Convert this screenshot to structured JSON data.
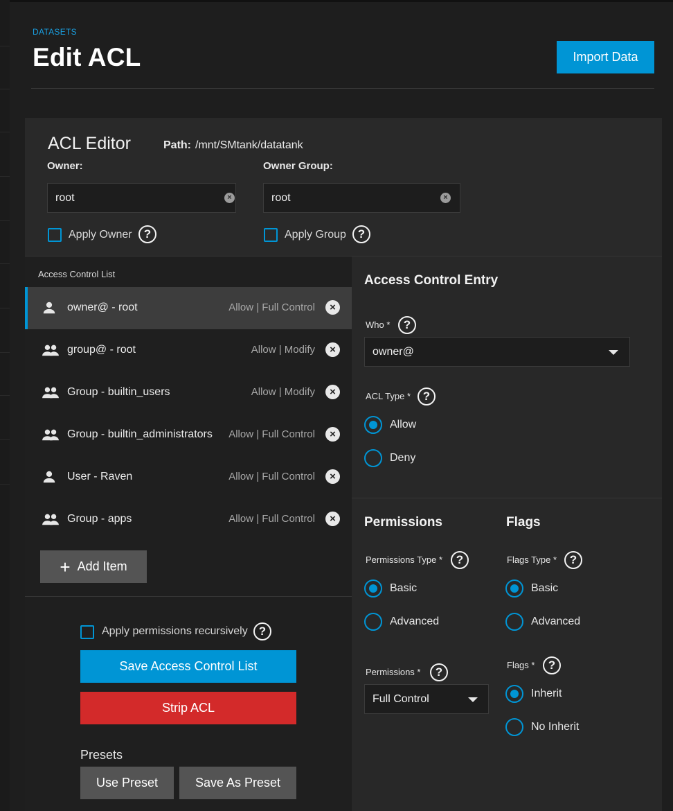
{
  "header": {
    "breadcrumb": "DATASETS",
    "title": "Edit ACL",
    "import_label": "Import Data"
  },
  "editor": {
    "title": "ACL Editor",
    "path_label": "Path:",
    "path_value": "/mnt/SMtank/datatank",
    "owner": {
      "label": "Owner:",
      "value": "root",
      "apply_label": "Apply Owner",
      "apply_checked": false
    },
    "owner_group": {
      "label": "Owner Group:",
      "value": "root",
      "apply_label": "Apply Group",
      "apply_checked": false
    }
  },
  "acl_list": {
    "caption": "Access Control List",
    "items": [
      {
        "icon": "person-icon",
        "name": "owner@ - root",
        "perm": "Allow | Full Control",
        "selected": true
      },
      {
        "icon": "group-icon",
        "name": "group@ - root",
        "perm": "Allow | Modify",
        "selected": false
      },
      {
        "icon": "group-icon",
        "name": "Group - builtin_users",
        "perm": "Allow | Modify",
        "selected": false
      },
      {
        "icon": "group-icon",
        "name": "Group - builtin_administrators",
        "perm": "Allow | Full Control",
        "selected": false
      },
      {
        "icon": "person-icon",
        "name": "User - Raven",
        "perm": "Allow | Full Control",
        "selected": false
      },
      {
        "icon": "group-icon",
        "name": "Group - apps",
        "perm": "Allow | Full Control",
        "selected": false
      }
    ],
    "add_label": "Add Item"
  },
  "actions": {
    "recursive_label": "Apply permissions recursively",
    "recursive_checked": false,
    "save_label": "Save Access Control List",
    "strip_label": "Strip ACL",
    "presets_title": "Presets",
    "use_preset_label": "Use Preset",
    "save_preset_label": "Save As Preset"
  },
  "ace": {
    "title": "Access Control Entry",
    "who_label": "Who *",
    "who_value": "owner@",
    "acl_type_label": "ACL Type *",
    "acl_type_options": [
      "Allow",
      "Deny"
    ],
    "acl_type_selected": "Allow",
    "permissions": {
      "title": "Permissions",
      "type_label": "Permissions Type *",
      "type_options": [
        "Basic",
        "Advanced"
      ],
      "type_selected": "Basic",
      "select_label": "Permissions *",
      "select_value": "Full Control"
    },
    "flags": {
      "title": "Flags",
      "type_label": "Flags Type *",
      "type_options": [
        "Basic",
        "Advanced"
      ],
      "type_selected": "Basic",
      "flags_label": "Flags *",
      "flags_options": [
        "Inherit",
        "No Inherit"
      ],
      "flags_selected": "Inherit"
    }
  },
  "colors": {
    "accent": "#0095d5",
    "danger": "#d32a2a",
    "background": "#1e1e1e"
  }
}
